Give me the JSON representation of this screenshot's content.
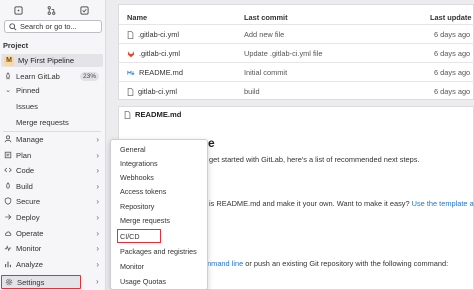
{
  "sidebar": {
    "search_placeholder": "Search or go to...",
    "section_label": "Project",
    "project": {
      "avatar_letter": "M",
      "name": "My First Pipeline"
    },
    "learn": {
      "label": "Learn GitLab",
      "badge": "23%"
    },
    "pinned": {
      "label": "Pinned",
      "items": [
        "Issues",
        "Merge requests"
      ]
    },
    "items": [
      "Manage",
      "Plan",
      "Code",
      "Build",
      "Secure",
      "Deploy",
      "Operate",
      "Monitor",
      "Analyze",
      "Settings"
    ]
  },
  "files": {
    "headers": {
      "name": "Name",
      "last_commit": "Last commit",
      "last_update": "Last update"
    },
    "rows": [
      {
        "name": ".gitlab-ci.yml",
        "commit": "Add new file",
        "update": "6 days ago",
        "icon": "file-icon"
      },
      {
        "name": ".gitlab-ci.yml",
        "commit": "Update .gitlab-ci.yml file",
        "update": "6 days ago",
        "icon": "gitlab-icon"
      },
      {
        "name": "README.md",
        "commit": "Initial commit",
        "update": "6 days ago",
        "icon": "markdown-icon"
      },
      {
        "name": "gitlab-ci.yml",
        "commit": "build",
        "update": "6 days ago",
        "icon": "file-icon"
      }
    ]
  },
  "readme": {
    "filename": "README.md",
    "heading_partial": "e",
    "line1": "get started with GitLab, here's a list of recommended next steps.",
    "line2_text": "is README.md and make it your own. Want to make it easy? ",
    "line2_link": "Use the template at the",
    "line3_link": "mmand line",
    "line3_text": " or push an existing Git repository with the following command:"
  },
  "dropdown": {
    "items": [
      "General",
      "Integrations",
      "Webhooks",
      "Access tokens",
      "Repository",
      "Merge requests",
      "CI/CD",
      "Packages and registries",
      "Monitor",
      "Usage Quotas"
    ],
    "highlighted": "CI/CD"
  },
  "colors": {
    "highlight_border": "#e0303b",
    "link": "#1f75cb"
  }
}
